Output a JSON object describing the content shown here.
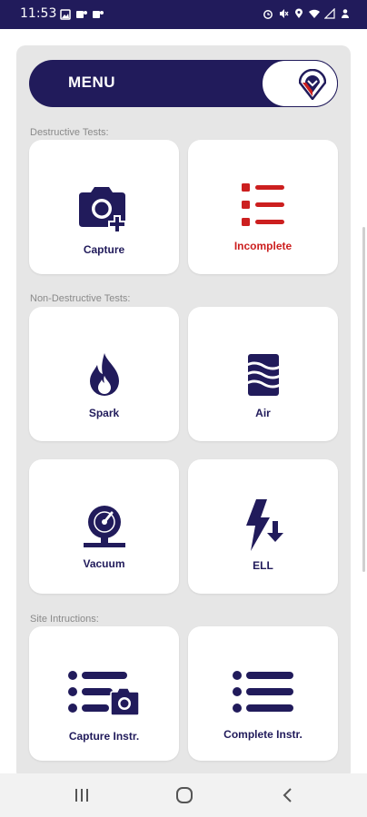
{
  "status_bar": {
    "time": "11:53",
    "left_icons": [
      "image-icon",
      "teams-icon",
      "teams-icon"
    ],
    "right_icons": [
      "alarm-icon",
      "mute-icon",
      "location-icon",
      "wifi-icon",
      "signal-icon",
      "person-icon"
    ]
  },
  "menu": {
    "title": "MENU",
    "logo_icon": "shield-logo-icon"
  },
  "sections": {
    "destructive": "Destructive Tests:",
    "non_destructive": "Non-Destructive Tests:",
    "site": "Site Intructions:"
  },
  "tiles": {
    "capture": "Capture",
    "incomplete": "Incomplete",
    "spark": "Spark",
    "air": "Air",
    "vacuum": "Vacuum",
    "ell": "ELL",
    "capture_instr": "Capture Instr.",
    "complete_instr": "Complete Instr."
  },
  "colors": {
    "primary": "#211b5b",
    "accent_red": "#cc1f1f",
    "panel_bg": "#e6e6e6"
  },
  "nav_bar": {
    "buttons": [
      "recent-apps-icon",
      "home-icon",
      "back-icon"
    ]
  }
}
